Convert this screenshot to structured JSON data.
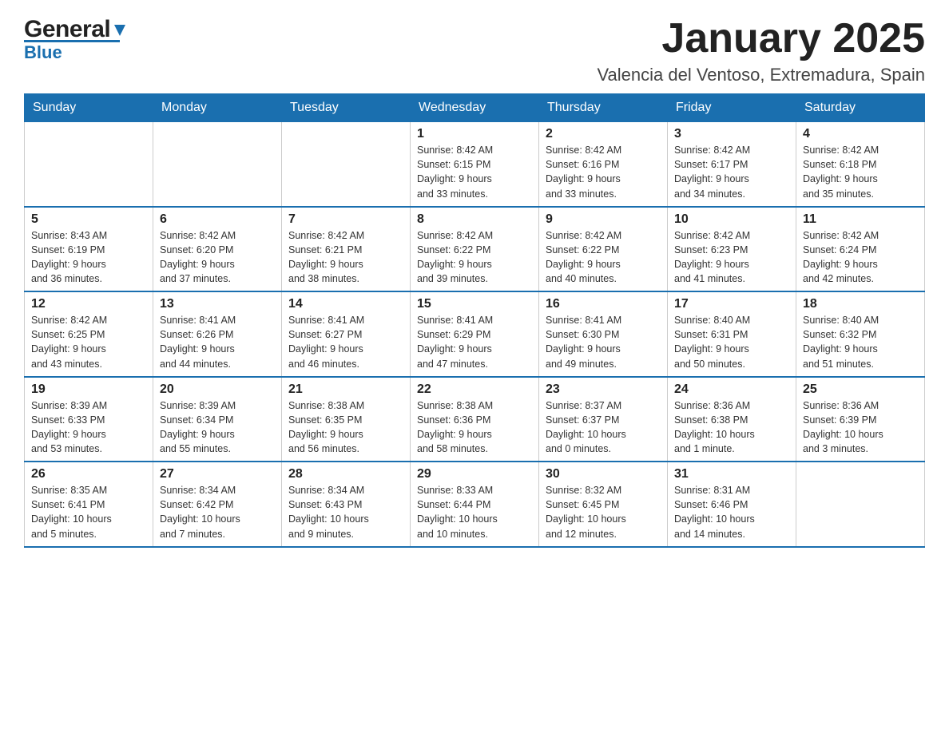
{
  "header": {
    "logo_general": "General",
    "logo_blue": "Blue",
    "title": "January 2025",
    "subtitle": "Valencia del Ventoso, Extremadura, Spain"
  },
  "weekdays": [
    "Sunday",
    "Monday",
    "Tuesday",
    "Wednesday",
    "Thursday",
    "Friday",
    "Saturday"
  ],
  "weeks": [
    [
      {
        "day": "",
        "info": ""
      },
      {
        "day": "",
        "info": ""
      },
      {
        "day": "",
        "info": ""
      },
      {
        "day": "1",
        "info": "Sunrise: 8:42 AM\nSunset: 6:15 PM\nDaylight: 9 hours\nand 33 minutes."
      },
      {
        "day": "2",
        "info": "Sunrise: 8:42 AM\nSunset: 6:16 PM\nDaylight: 9 hours\nand 33 minutes."
      },
      {
        "day": "3",
        "info": "Sunrise: 8:42 AM\nSunset: 6:17 PM\nDaylight: 9 hours\nand 34 minutes."
      },
      {
        "day": "4",
        "info": "Sunrise: 8:42 AM\nSunset: 6:18 PM\nDaylight: 9 hours\nand 35 minutes."
      }
    ],
    [
      {
        "day": "5",
        "info": "Sunrise: 8:43 AM\nSunset: 6:19 PM\nDaylight: 9 hours\nand 36 minutes."
      },
      {
        "day": "6",
        "info": "Sunrise: 8:42 AM\nSunset: 6:20 PM\nDaylight: 9 hours\nand 37 minutes."
      },
      {
        "day": "7",
        "info": "Sunrise: 8:42 AM\nSunset: 6:21 PM\nDaylight: 9 hours\nand 38 minutes."
      },
      {
        "day": "8",
        "info": "Sunrise: 8:42 AM\nSunset: 6:22 PM\nDaylight: 9 hours\nand 39 minutes."
      },
      {
        "day": "9",
        "info": "Sunrise: 8:42 AM\nSunset: 6:22 PM\nDaylight: 9 hours\nand 40 minutes."
      },
      {
        "day": "10",
        "info": "Sunrise: 8:42 AM\nSunset: 6:23 PM\nDaylight: 9 hours\nand 41 minutes."
      },
      {
        "day": "11",
        "info": "Sunrise: 8:42 AM\nSunset: 6:24 PM\nDaylight: 9 hours\nand 42 minutes."
      }
    ],
    [
      {
        "day": "12",
        "info": "Sunrise: 8:42 AM\nSunset: 6:25 PM\nDaylight: 9 hours\nand 43 minutes."
      },
      {
        "day": "13",
        "info": "Sunrise: 8:41 AM\nSunset: 6:26 PM\nDaylight: 9 hours\nand 44 minutes."
      },
      {
        "day": "14",
        "info": "Sunrise: 8:41 AM\nSunset: 6:27 PM\nDaylight: 9 hours\nand 46 minutes."
      },
      {
        "day": "15",
        "info": "Sunrise: 8:41 AM\nSunset: 6:29 PM\nDaylight: 9 hours\nand 47 minutes."
      },
      {
        "day": "16",
        "info": "Sunrise: 8:41 AM\nSunset: 6:30 PM\nDaylight: 9 hours\nand 49 minutes."
      },
      {
        "day": "17",
        "info": "Sunrise: 8:40 AM\nSunset: 6:31 PM\nDaylight: 9 hours\nand 50 minutes."
      },
      {
        "day": "18",
        "info": "Sunrise: 8:40 AM\nSunset: 6:32 PM\nDaylight: 9 hours\nand 51 minutes."
      }
    ],
    [
      {
        "day": "19",
        "info": "Sunrise: 8:39 AM\nSunset: 6:33 PM\nDaylight: 9 hours\nand 53 minutes."
      },
      {
        "day": "20",
        "info": "Sunrise: 8:39 AM\nSunset: 6:34 PM\nDaylight: 9 hours\nand 55 minutes."
      },
      {
        "day": "21",
        "info": "Sunrise: 8:38 AM\nSunset: 6:35 PM\nDaylight: 9 hours\nand 56 minutes."
      },
      {
        "day": "22",
        "info": "Sunrise: 8:38 AM\nSunset: 6:36 PM\nDaylight: 9 hours\nand 58 minutes."
      },
      {
        "day": "23",
        "info": "Sunrise: 8:37 AM\nSunset: 6:37 PM\nDaylight: 10 hours\nand 0 minutes."
      },
      {
        "day": "24",
        "info": "Sunrise: 8:36 AM\nSunset: 6:38 PM\nDaylight: 10 hours\nand 1 minute."
      },
      {
        "day": "25",
        "info": "Sunrise: 8:36 AM\nSunset: 6:39 PM\nDaylight: 10 hours\nand 3 minutes."
      }
    ],
    [
      {
        "day": "26",
        "info": "Sunrise: 8:35 AM\nSunset: 6:41 PM\nDaylight: 10 hours\nand 5 minutes."
      },
      {
        "day": "27",
        "info": "Sunrise: 8:34 AM\nSunset: 6:42 PM\nDaylight: 10 hours\nand 7 minutes."
      },
      {
        "day": "28",
        "info": "Sunrise: 8:34 AM\nSunset: 6:43 PM\nDaylight: 10 hours\nand 9 minutes."
      },
      {
        "day": "29",
        "info": "Sunrise: 8:33 AM\nSunset: 6:44 PM\nDaylight: 10 hours\nand 10 minutes."
      },
      {
        "day": "30",
        "info": "Sunrise: 8:32 AM\nSunset: 6:45 PM\nDaylight: 10 hours\nand 12 minutes."
      },
      {
        "day": "31",
        "info": "Sunrise: 8:31 AM\nSunset: 6:46 PM\nDaylight: 10 hours\nand 14 minutes."
      },
      {
        "day": "",
        "info": ""
      }
    ]
  ]
}
